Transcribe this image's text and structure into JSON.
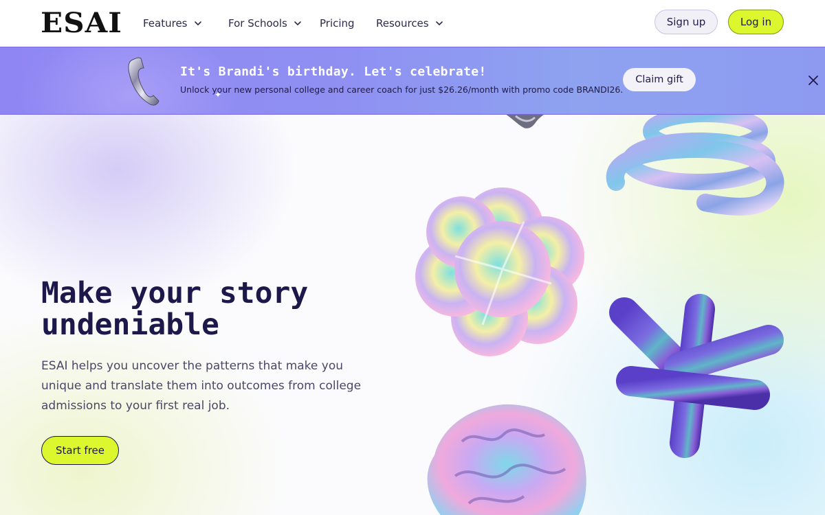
{
  "nav": {
    "logo": "ESAI",
    "items": [
      {
        "label": "Features",
        "has_dropdown": true
      },
      {
        "label": "For Schools",
        "has_dropdown": true
      },
      {
        "label": "Pricing",
        "has_dropdown": false
      },
      {
        "label": "Resources",
        "has_dropdown": true
      }
    ],
    "signup_label": "Sign up",
    "login_label": "Log in"
  },
  "banner": {
    "title": "It's Brandi's birthday. Let's celebrate!",
    "subtitle": "Unlock your new personal college and career coach for just $26.26/month with promo code BRANDI26.",
    "claim_label": "Claim gift",
    "close_icon": "close-icon",
    "phone_icon": "phone-icon"
  },
  "hero": {
    "title_line1": "Make your story",
    "title_line2": "undeniable",
    "description": "ESAI helps you uncover the patterns that make you unique and translate them into outcomes from college admissions to your first real job.",
    "cta_label": "Start free"
  },
  "colors": {
    "accent_lime": "#dcf72d",
    "banner_purple": "#8f86f3",
    "heading_navy": "#1d184a"
  }
}
